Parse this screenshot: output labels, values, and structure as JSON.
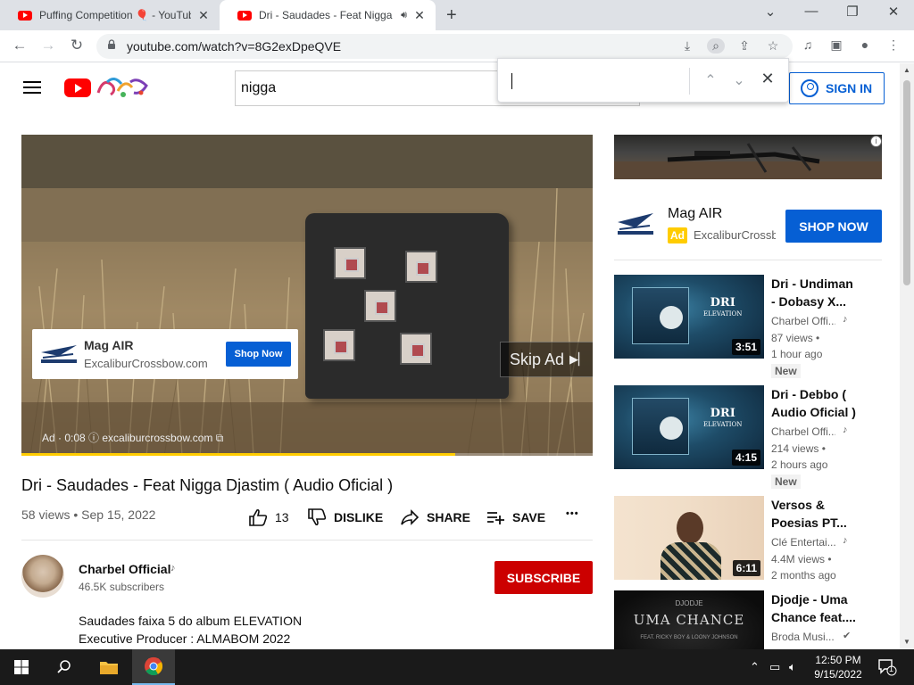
{
  "browser": {
    "tabs": [
      {
        "title": "Puffing Competition 🎈 - YouTube",
        "active": false
      },
      {
        "title": "Dri - Saudades - Feat Nigga Djastim",
        "active": true,
        "audio": true
      }
    ],
    "new_tab_symbol": "+",
    "window_controls": {
      "dropdown": "⌄",
      "minimize": "—",
      "restore": "❐",
      "close": "✕"
    },
    "url": "youtube.com/watch?v=8G2exDpeQVE",
    "find_bar": {
      "query": "",
      "prev": "⌃",
      "next": "⌄",
      "close": "✕"
    }
  },
  "header": {
    "search_value": "nigga",
    "signin_label": "SIGN IN"
  },
  "player": {
    "ad_card": {
      "name": "Mag AIR",
      "domain": "ExcaliburCrossbow.com",
      "shop_label": "Shop Now"
    },
    "skip_label": "Skip Ad",
    "ad_info": "Ad · 0:08  ⓘ  excaliburcrossbow.com ⧉",
    "progress": 0.76,
    "progress_color": "#ffcc00"
  },
  "video": {
    "title": "Dri - Saudades - Feat Nigga Djastim ( Audio Oficial )",
    "meta": "58 views • Sep 15, 2022",
    "actions": {
      "like_count": "13",
      "dislike_label": "DISLIKE",
      "share_label": "SHARE",
      "save_label": "SAVE",
      "more_label": "•••"
    }
  },
  "channel": {
    "name": "Charbel Official",
    "music_note": "♪",
    "subscribers": "46.5K subscribers",
    "subscribe_label": "SUBSCRIBE",
    "description": [
      "Saudades faixa 5 do album ELEVATION",
      "Executive Producer : ALMABOM 2022"
    ]
  },
  "sidebar": {
    "ad": {
      "info_icon": "i",
      "name": "Mag AIR",
      "badge": "Ad",
      "domain": "ExcaliburCrossbow.com",
      "shop_label": "SHOP NOW"
    },
    "recommendations": [
      {
        "title": "Dri - Undiman - Dobasy X...",
        "channel": "Charbel Offi...",
        "note": "♪",
        "views": "87 views •",
        "age": "1 hour ago",
        "new": "New",
        "duration": "3:51",
        "thumb": "dri",
        "album_title": "DRI",
        "album_sub": "ELEVATION"
      },
      {
        "title": "Dri - Debbo ( Audio Oficial )",
        "channel": "Charbel Offi...",
        "note": "♪",
        "views": "214 views •",
        "age": "2 hours ago",
        "new": "New",
        "duration": "4:15",
        "thumb": "dri",
        "album_title": "DRI",
        "album_sub": "ELEVATION"
      },
      {
        "title": "Versos & Poesias PT...",
        "channel": "Clé Entertai...",
        "note": "♪",
        "views": "4.4M views •",
        "age": "2 months ago",
        "new": "",
        "duration": "6:11",
        "thumb": "versos"
      },
      {
        "title": "Djodje - Uma Chance feat....",
        "channel": "Broda Musi...",
        "note": "✔",
        "views": "",
        "age": "",
        "new": "",
        "duration": "",
        "thumb": "uma",
        "thumb_title": "UMA CHANCE",
        "thumb_sub": "DJODJE",
        "thumb_feat": "FEAT. RICKY BOY & LOONY JOHNSON"
      }
    ]
  },
  "taskbar": {
    "time": "12:50 PM",
    "date": "9/15/2022",
    "notification_count": "1"
  },
  "colors": {
    "youtube_red": "#ff0000",
    "subscribe_red": "#cc0000",
    "link_blue": "#065fd4",
    "ad_yellow": "#ffcc00"
  }
}
